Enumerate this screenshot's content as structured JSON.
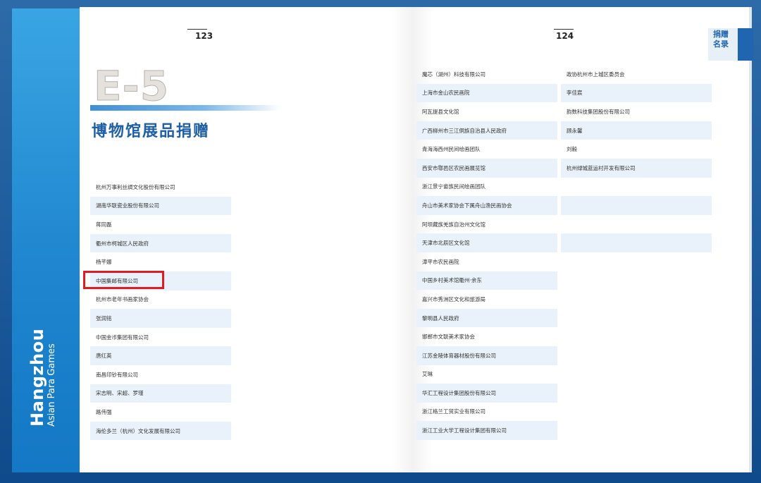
{
  "spine": {
    "title": "Hangzhou",
    "subtitle": "Asian Para Games"
  },
  "page_left": {
    "page_number": "123",
    "section_code": "E-5",
    "section_title": "博物馆展品捐赠",
    "donors": [
      "杭州万事利丝绸文化股份有限公司",
      "湖南华联瓷业股份有限公司",
      "蒋同磊",
      "衢州市柯城区人民政府",
      "杨芊娜",
      "中国集邮有限公司",
      "杭州市老年书画家协会",
      "张润铭",
      "中国金币集团有限公司",
      "唐红英",
      "南昌印钞有限公司",
      "宋志明、宋超、罗瑾",
      "路伟强",
      "海伦多兰（杭州）文化发展有限公司"
    ],
    "highlighted_index": 5
  },
  "page_right": {
    "page_number": "124",
    "tab_label": "捐赠名录",
    "tab_line1": "捐赠",
    "tab_line2": "名录",
    "column1": [
      "魔芯（湖州）科技有限公司",
      "上海市金山农民画院",
      "阿瓦提县文化馆",
      "广西柳州市三江侗族自治县人民政府",
      "青海海西州民间绘画团队",
      "西安市鄠邑区农民画展览馆",
      "浙江景宁畲族民间绘画团队",
      "舟山市美术家协会下属舟山渔民画协会",
      "阿坝藏族羌族自治州文化馆",
      "天津市北辰区文化馆",
      "漳平市农民画院",
      "中国乡村美术馆衢州·余东",
      "嘉兴市秀洲区文化和旅游局",
      "黎明县人民政府",
      "邯郸市文联美术家协会",
      "江苏金陵体育器材股份有限公司",
      "艾琳",
      "华汇工程设计集团股份有限公司",
      "浙江格兰工贸实业有限公司",
      "浙江工业大学工程设计集团有限公司"
    ],
    "column2": [
      "政协杭州市上城区委员会",
      "李佳宸",
      "韵数科技集团股份有限公司",
      "顾永馨",
      "刘毅",
      "杭州绿城蓝运村开发有限公司"
    ]
  }
}
